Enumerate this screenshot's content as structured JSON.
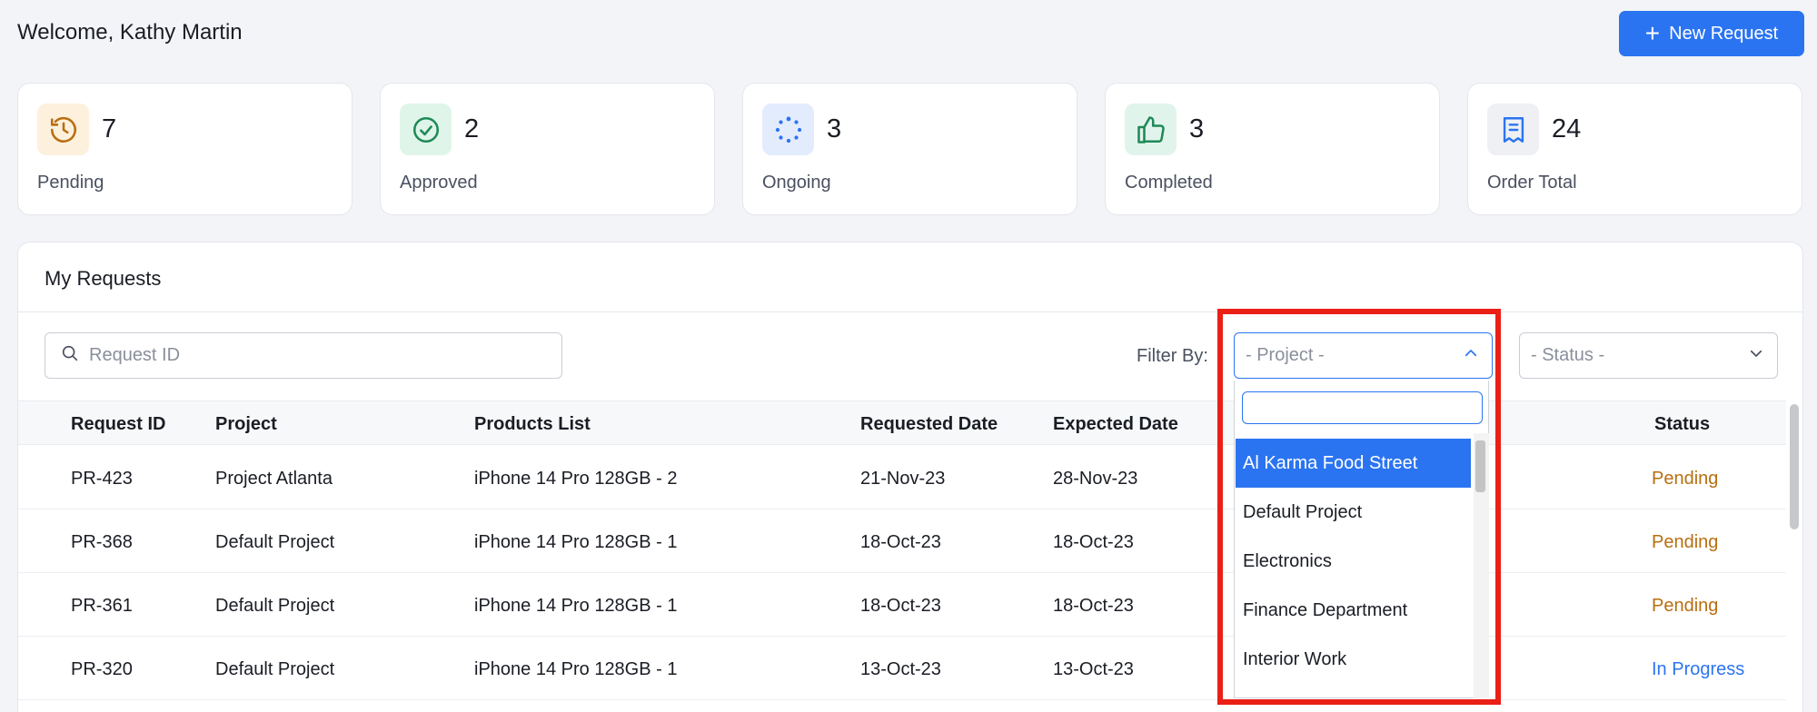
{
  "header": {
    "welcome": "Welcome, Kathy Martin",
    "new_request_label": "New Request"
  },
  "stats": [
    {
      "value": "7",
      "label": "Pending",
      "icon": "history-icon",
      "color": "#b86e0f"
    },
    {
      "value": "2",
      "label": "Approved",
      "icon": "check-circle-icon",
      "color": "#1f8a57"
    },
    {
      "value": "3",
      "label": "Ongoing",
      "icon": "loading-dots-icon",
      "color": "#2b74f1"
    },
    {
      "value": "3",
      "label": "Completed",
      "icon": "thumbs-up-icon",
      "color": "#1f8a57"
    },
    {
      "value": "24",
      "label": "Order Total",
      "icon": "receipt-icon",
      "color": "#2b74f1"
    }
  ],
  "requests": {
    "title": "My Requests",
    "search_placeholder": "Request ID",
    "filter_label": "Filter By:",
    "project_select": "- Project -",
    "status_select": "- Status -",
    "columns": {
      "id": "Request ID",
      "project": "Project",
      "products": "Products List",
      "requested": "Requested Date",
      "expected": "Expected Date",
      "status": "Status"
    },
    "rows": [
      {
        "id": "PR-423",
        "project": "Project Atlanta",
        "products": "iPhone 14 Pro 128GB - 2",
        "requested": "21-Nov-23",
        "expected": "28-Nov-23",
        "status": "Pending"
      },
      {
        "id": "PR-368",
        "project": "Default Project",
        "products": "iPhone 14 Pro 128GB - 1",
        "requested": "18-Oct-23",
        "expected": "18-Oct-23",
        "status": "Pending"
      },
      {
        "id": "PR-361",
        "project": "Default Project",
        "products": "iPhone 14 Pro 128GB - 1",
        "requested": "18-Oct-23",
        "expected": "18-Oct-23",
        "status": "Pending"
      },
      {
        "id": "PR-320",
        "project": "Default Project",
        "products": "iPhone 14 Pro 128GB - 1",
        "requested": "13-Oct-23",
        "expected": "13-Oct-23",
        "status": "In Progress"
      }
    ]
  },
  "project_dropdown": {
    "search_value": "",
    "options": [
      "Al Karma Food Street",
      "Default Project",
      "Electronics",
      "Finance Department",
      "Interior Work"
    ],
    "selected": "Al Karma Food Street"
  },
  "colors": {
    "accent": "#2b74f1",
    "pending": "#b86e0f",
    "highlight": "#ea1f16"
  }
}
